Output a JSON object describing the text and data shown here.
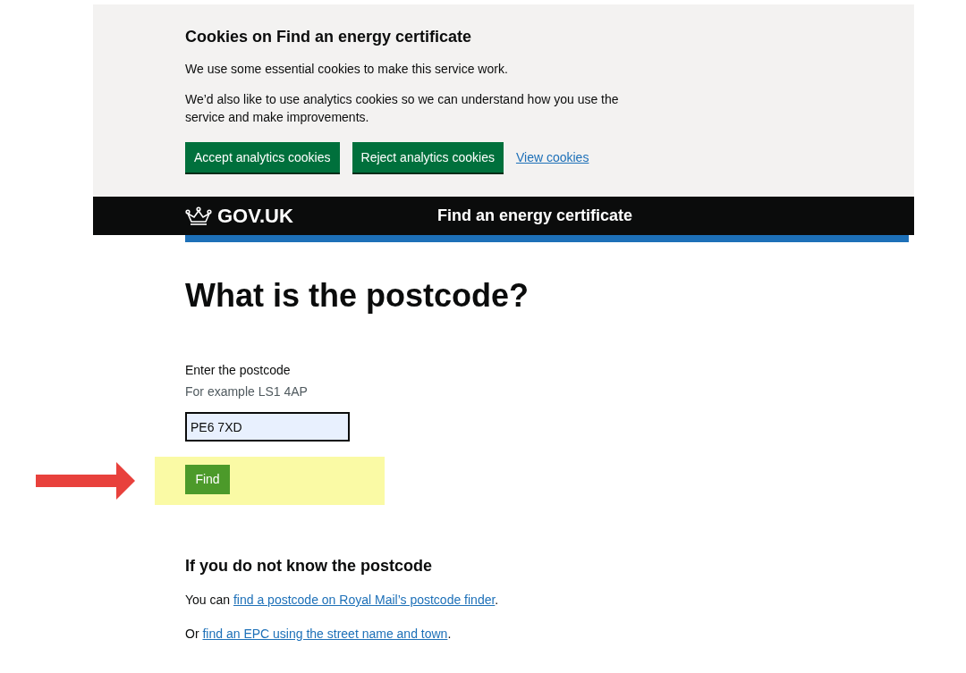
{
  "cookie_banner": {
    "title": "Cookies on Find an energy certificate",
    "paragraphs": [
      "We use some essential cookies to make this service work.",
      "We’d also like to use analytics cookies so we can understand how you use the service and make improvements."
    ],
    "buttons": [
      "Accept analytics cookies",
      "Reject analytics cookies"
    ],
    "link": "View cookies"
  },
  "header": {
    "logo": "GOV.UK",
    "service_name": "Find an energy certificate"
  },
  "main": {
    "heading": "What is the postcode?",
    "field": {
      "label": "Enter the postcode",
      "hint": "For example LS1 4AP",
      "value": "PE6 7XD"
    },
    "button": "Find",
    "help": {
      "heading": "If you do not know the postcode",
      "lines": [
        {
          "prefix": "You can ",
          "link": "find a postcode on Royal Mail’s postcode finder",
          "suffix": "."
        },
        {
          "prefix": "Or ",
          "link": "find an EPC using the street name and town",
          "suffix": "."
        }
      ]
    }
  }
}
